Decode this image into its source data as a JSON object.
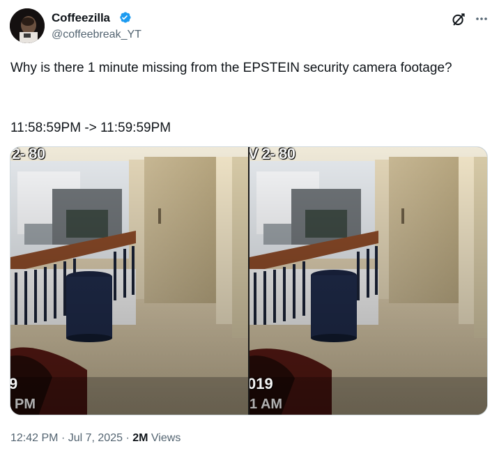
{
  "author": {
    "display_name": "Coffeezilla",
    "handle": "@coffeebreak_YT",
    "verified": true,
    "avatar_icon": "avatar-photo"
  },
  "tweet": {
    "text": "Why is there 1 minute missing from the EPSTEIN security camera footage?",
    "timestamps_line": "11:58:59PM -> 11:59:59PM"
  },
  "media": {
    "left_frame": {
      "overlay_top": "2- 80",
      "overlay_mid": "9",
      "overlay_bottom": "PM"
    },
    "right_frame": {
      "overlay_top": "V 2- 80",
      "overlay_mid": "019",
      "overlay_bottom": "1 AM"
    }
  },
  "meta": {
    "time": "12:42 PM",
    "separator": "·",
    "date": "Jul 7, 2025",
    "views_count": "2M",
    "views_label": "Views"
  },
  "icons": {
    "verified": "verified-badge-icon",
    "grok": "grok-icon",
    "more": "more-icon"
  },
  "colors": {
    "verified_blue": "#1d9bf0",
    "secondary_text": "#536471",
    "primary_text": "#0f1419"
  }
}
